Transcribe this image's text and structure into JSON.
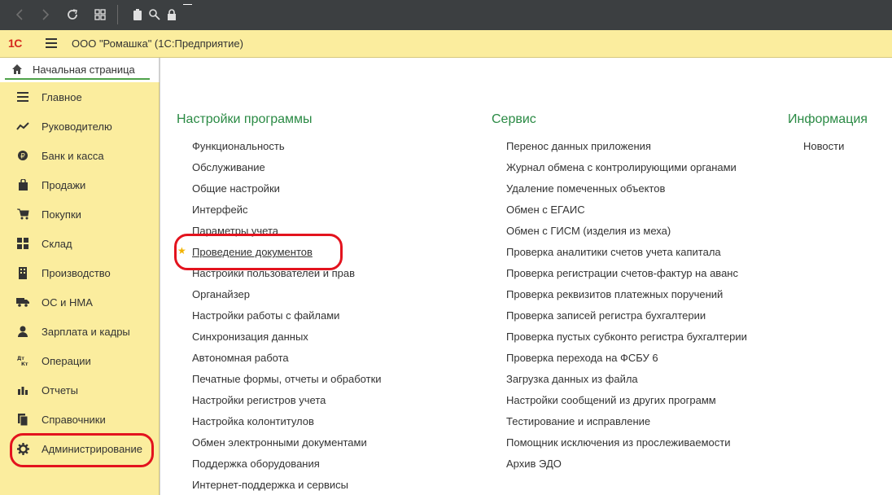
{
  "browser": {
    "back_icon": "chevron-left-icon",
    "forward_icon": "chevron-right-icon",
    "refresh_icon": "refresh-icon",
    "grid_icon": "grid-icon",
    "clipboard_icon": "clipboard-icon",
    "search_icon": "search-icon",
    "lock_icon": "lock-icon"
  },
  "app": {
    "logo": "1С",
    "title": "ООО \"Ромашка\"  (1С:Предприятие)"
  },
  "home_tab": {
    "label": "Начальная страница"
  },
  "sidebar": {
    "items": [
      {
        "label": "Главное",
        "icon": "menu-lines-icon"
      },
      {
        "label": "Руководителю",
        "icon": "trend-icon"
      },
      {
        "label": "Банк и касса",
        "icon": "coin-icon"
      },
      {
        "label": "Продажи",
        "icon": "shopping-bag-icon"
      },
      {
        "label": "Покупки",
        "icon": "cart-icon"
      },
      {
        "label": "Склад",
        "icon": "warehouse-icon"
      },
      {
        "label": "Производство",
        "icon": "factory-icon"
      },
      {
        "label": "ОС и НМА",
        "icon": "truck-icon"
      },
      {
        "label": "Зарплата и кадры",
        "icon": "person-icon"
      },
      {
        "label": "Операции",
        "icon": "dt-kt-icon"
      },
      {
        "label": "Отчеты",
        "icon": "bar-chart-icon"
      },
      {
        "label": "Справочники",
        "icon": "books-icon"
      },
      {
        "label": "Администрирование",
        "icon": "gear-icon"
      }
    ]
  },
  "sections": {
    "settings": {
      "title": "Настройки программы",
      "links": [
        "Функциональность",
        "Обслуживание",
        "Общие настройки",
        "Интерфейс",
        "Параметры учета",
        "Проведение документов",
        "Настройки пользователей и прав",
        "Органайзер",
        "Настройки работы с файлами",
        "Синхронизация данных",
        "Автономная работа",
        "Печатные формы, отчеты и обработки",
        "Настройки регистров учета",
        "Настройка колонтитулов",
        "Обмен электронными документами",
        "Поддержка оборудования",
        "Интернет-поддержка и сервисы"
      ]
    },
    "service": {
      "title": "Сервис",
      "links": [
        "Перенос данных приложения",
        "Журнал обмена с контролирующими органами",
        "Удаление помеченных объектов",
        "Обмен с ЕГАИС",
        "Обмен с ГИСМ (изделия из меха)",
        "Проверка аналитики счетов учета капитала",
        "Проверка регистрации счетов-фактур на аванс",
        "Проверка реквизитов платежных поручений",
        "Проверка записей регистра бухгалтерии",
        "Проверка пустых субконто регистра бухгалтерии",
        "Проверка перехода на ФСБУ 6",
        "Загрузка данных из файла",
        "Настройки сообщений из других программ",
        "Тестирование и исправление",
        "Помощник исключения из прослеживаемости",
        "Архив ЭДО"
      ]
    },
    "info": {
      "title": "Информация",
      "links": [
        "Новости"
      ]
    }
  },
  "colors": {
    "accent_green": "#2a8a44",
    "header_yellow": "#fbed9e",
    "highlight_red": "#e3131e",
    "star": "#f2b300"
  }
}
